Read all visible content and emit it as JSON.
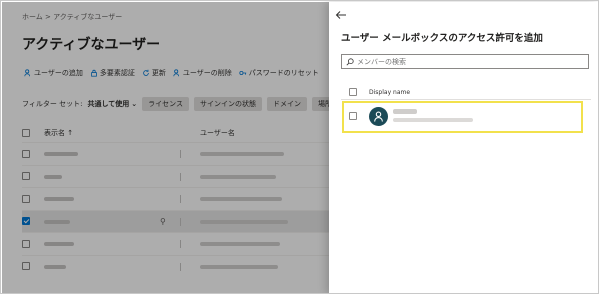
{
  "background_page": {
    "breadcrumb": "ホーム  >  アクティブなユーザー",
    "title": "アクティブなユーザー",
    "commands": [
      {
        "icon": "add-user-icon",
        "label": "ユーザーの追加"
      },
      {
        "icon": "lock-icon",
        "label": "多要素認証"
      },
      {
        "icon": "refresh-icon",
        "label": "更新"
      },
      {
        "icon": "delete-user-icon",
        "label": "ユーザーの削除"
      },
      {
        "icon": "key-icon",
        "label": "パスワードのリセット"
      }
    ],
    "filter": {
      "label": "フィルター セット:",
      "value": "共通して使用",
      "chips": [
        "ライセンス",
        "サインインの状態",
        "ドメイン",
        "場所"
      ]
    },
    "grid": {
      "columns": [
        "表示名 ↑",
        "ユーザー名"
      ],
      "selected_row_index": 3,
      "row_count": 6
    }
  },
  "panel": {
    "title": "ユーザー メールボックスのアクセス許可を追加",
    "search_placeholder": "メンバーの検索",
    "column_header": "Display name",
    "highlight_color": "#f2e14c",
    "avatar_color": "#1b4a57"
  }
}
